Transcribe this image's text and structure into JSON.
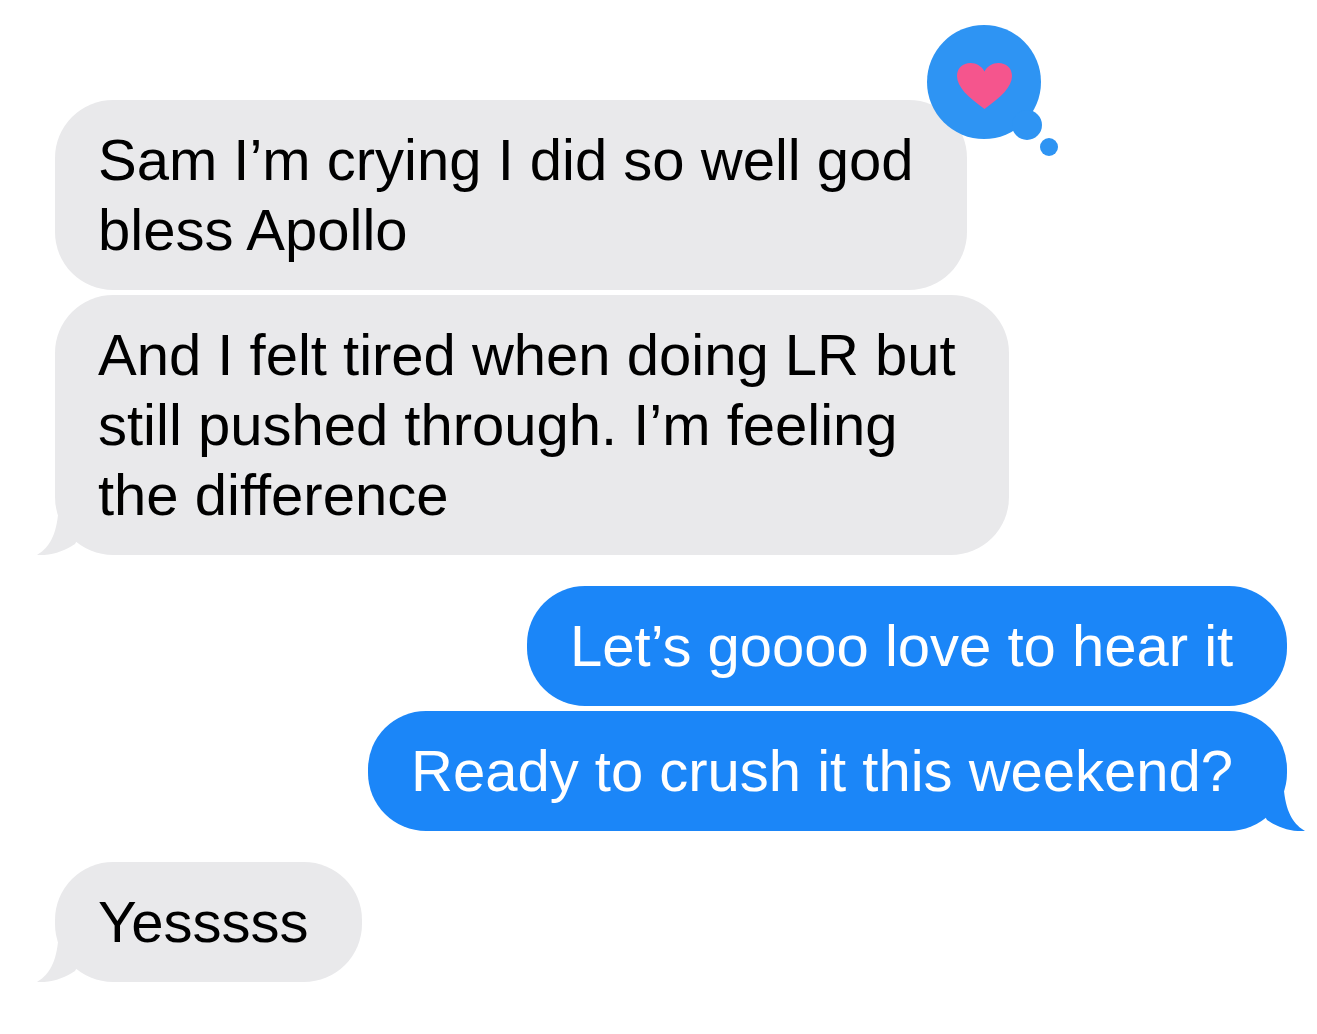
{
  "messages": [
    {
      "kind": "received",
      "text": "Sam I’m crying I did so well god bless Apollo",
      "tail": false,
      "loved": true
    },
    {
      "kind": "received",
      "text": "And I felt tired when doing LR but still pushed through. I’m feeling the difference",
      "tail": true,
      "loved": false
    },
    {
      "kind": "sent",
      "text": "Let’s goooo love to hear it",
      "tail": false,
      "loved": false
    },
    {
      "kind": "sent",
      "text": "Ready to crush it this weekend?",
      "tail": true,
      "loved": false
    },
    {
      "kind": "received",
      "text": "Yesssss",
      "tail": true,
      "loved": false
    }
  ]
}
